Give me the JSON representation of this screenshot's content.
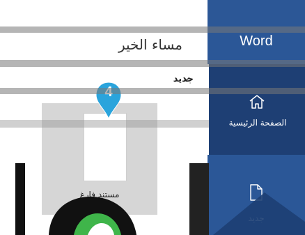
{
  "app": {
    "title": "Word"
  },
  "nav": {
    "items": [
      {
        "label": "الصفحة الرئيسية",
        "icon": "home-icon",
        "selected": true
      },
      {
        "label": "جديد",
        "icon": "new-document-icon",
        "selected": false
      }
    ]
  },
  "main": {
    "greeting": "مساء الخير",
    "new_section": {
      "heading": "جديد",
      "expand_icon": "chevron-down-icon"
    },
    "templates": [
      {
        "label": "مستند فارغ"
      }
    ]
  },
  "callout": {
    "step": "4"
  },
  "colors": {
    "nav_blue": "#2b5797",
    "nav_selected": "#1e3f74",
    "callout_blue": "#2aa4dc",
    "card_gray": "#d6d6d6"
  }
}
